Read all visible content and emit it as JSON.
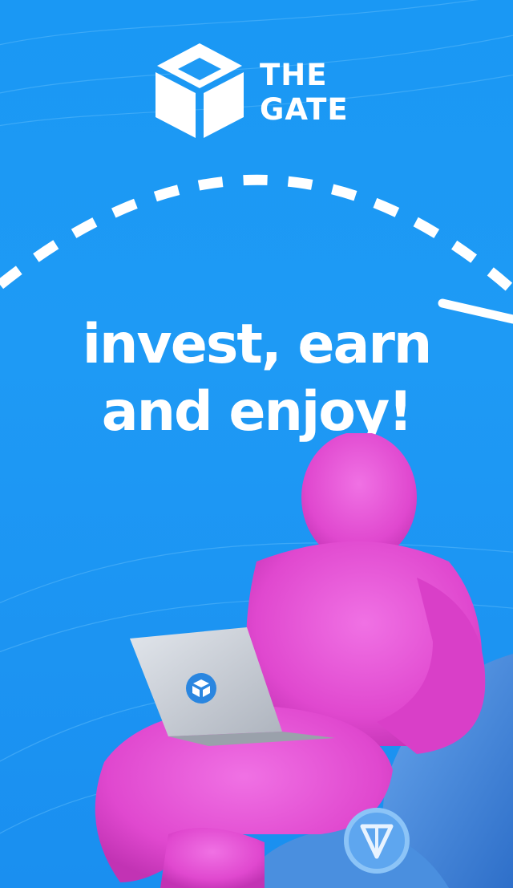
{
  "brand": {
    "line1": "THE",
    "line2": "GATE"
  },
  "headline": {
    "line1": "invest, earn",
    "line2": "and enjoy!"
  },
  "colors": {
    "background": "#1e9af5",
    "text": "#ffffff",
    "character": "#e84ed6",
    "laptop": "#c9ced6",
    "chair": "#3f86d9"
  },
  "icons": {
    "logo": "cube-icon",
    "laptop_badge": "cube-icon",
    "coin": "ton-icon"
  }
}
